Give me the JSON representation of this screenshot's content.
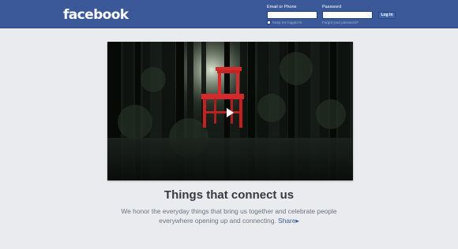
{
  "header": {
    "logo": "facebook",
    "email_label": "Email or Phone",
    "email_value": "",
    "password_label": "Password",
    "password_value": "",
    "login_button": "Log In",
    "keep_logged_in": "Keep me logged in",
    "forgot_password": "Forgot your password?"
  },
  "hero": {
    "headline": "Things that connect us",
    "description": "We honor the everyday things that bring us together and celebrate people everywhere opening up and connecting.",
    "share_link": "Share",
    "share_arrow": "▸"
  },
  "colors": {
    "brand": "#3b5998",
    "background": "#e9ebee",
    "chair": "#d32b2b"
  }
}
